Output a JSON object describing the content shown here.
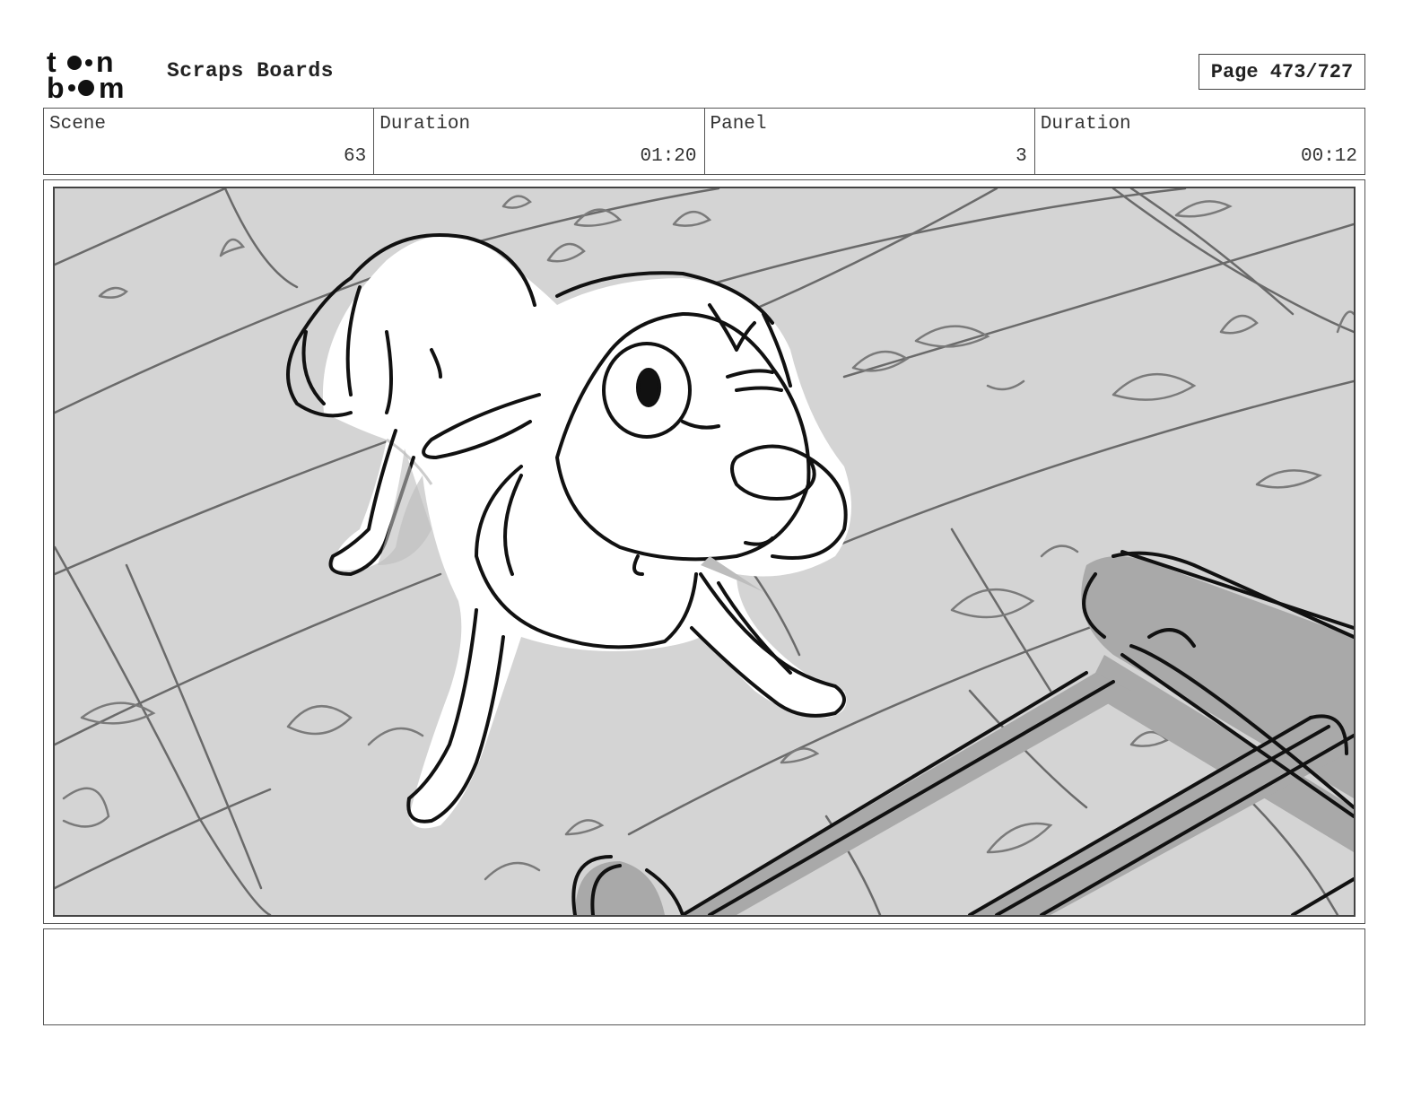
{
  "header": {
    "logo_text": "toon boom",
    "project_title": "Scraps Boards",
    "page_label": "Page 473/727"
  },
  "info": [
    {
      "label": "Scene",
      "value": "63"
    },
    {
      "label": "Duration",
      "value": "01:20"
    },
    {
      "label": "Panel",
      "value": "3"
    },
    {
      "label": "Duration",
      "value": "00:12"
    }
  ],
  "panel": {
    "description": "",
    "colors": {
      "floor": "#d4d4d4",
      "shadow": "#a9a9a9",
      "ink": "#111111",
      "body": "#ffffff"
    }
  },
  "notes": {
    "text": ""
  }
}
